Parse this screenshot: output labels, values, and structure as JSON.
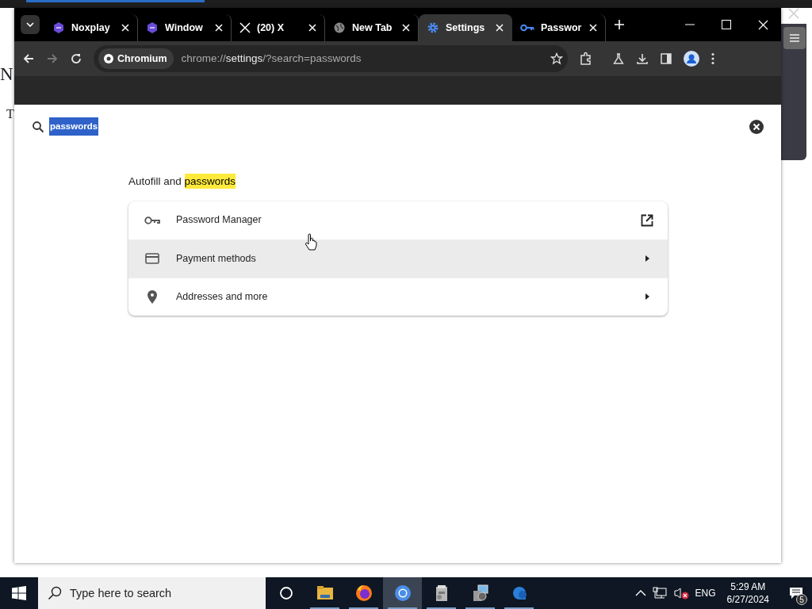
{
  "background_page": {
    "heading": "N",
    "text": "T"
  },
  "tabs": [
    {
      "title": "Noxplay",
      "selected": false
    },
    {
      "title": "Window",
      "selected": false
    },
    {
      "title": "(20) X",
      "selected": false
    },
    {
      "title": "New Tab",
      "selected": false
    },
    {
      "title": "Settings",
      "selected": true
    },
    {
      "title": "Passwor",
      "selected": false
    }
  ],
  "toolbar": {
    "chip": "Chromium",
    "url": "chrome://**settings**/?search=passwords"
  },
  "search": {
    "value": "passwords"
  },
  "section": {
    "title": "Autofill and ",
    "highlight": "passwords"
  },
  "rows": [
    {
      "label": "Password Manager",
      "kind": "external",
      "hovered": false
    },
    {
      "label": "Payment methods",
      "kind": "submenu",
      "hovered": true
    },
    {
      "label": "Addresses and more",
      "kind": "submenu",
      "hovered": false
    }
  ],
  "taskbar": {
    "search_placeholder": "Type here to search",
    "apps": [
      {
        "active": false
      },
      {
        "active": false
      },
      {
        "active": true
      },
      {
        "active": false
      },
      {
        "active": false
      },
      {
        "active": false
      }
    ],
    "language": "ENG",
    "time": "5:29 AM",
    "date": "6/27/2024",
    "notifications": "5"
  }
}
